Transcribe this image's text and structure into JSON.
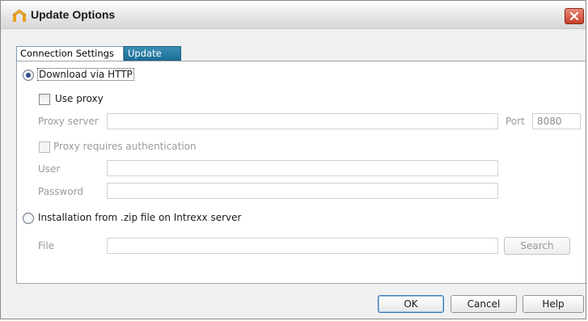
{
  "window": {
    "title": "Update Options",
    "icon": "intrexx-app-icon",
    "close_icon": "close-icon"
  },
  "tabs": [
    {
      "label": "Connection Settings",
      "active": true
    },
    {
      "label": "Update",
      "active": false
    }
  ],
  "connection": {
    "http_option_label": "Download via HTTP",
    "http_selected": true,
    "use_proxy_label": "Use proxy",
    "use_proxy_checked": false,
    "proxy_server_label": "Proxy server",
    "proxy_server_value": "",
    "port_label": "Port",
    "port_value": "8080",
    "proxy_auth_label": "Proxy requires authentication",
    "proxy_auth_checked": false,
    "user_label": "User",
    "user_value": "",
    "password_label": "Password",
    "password_value": "",
    "zip_option_label": "Installation from .zip file on Intrexx server",
    "zip_selected": false,
    "file_label": "File",
    "file_value": "",
    "search_label": "Search"
  },
  "footer": {
    "ok_label": "OK",
    "cancel_label": "Cancel",
    "help_label": "Help"
  }
}
